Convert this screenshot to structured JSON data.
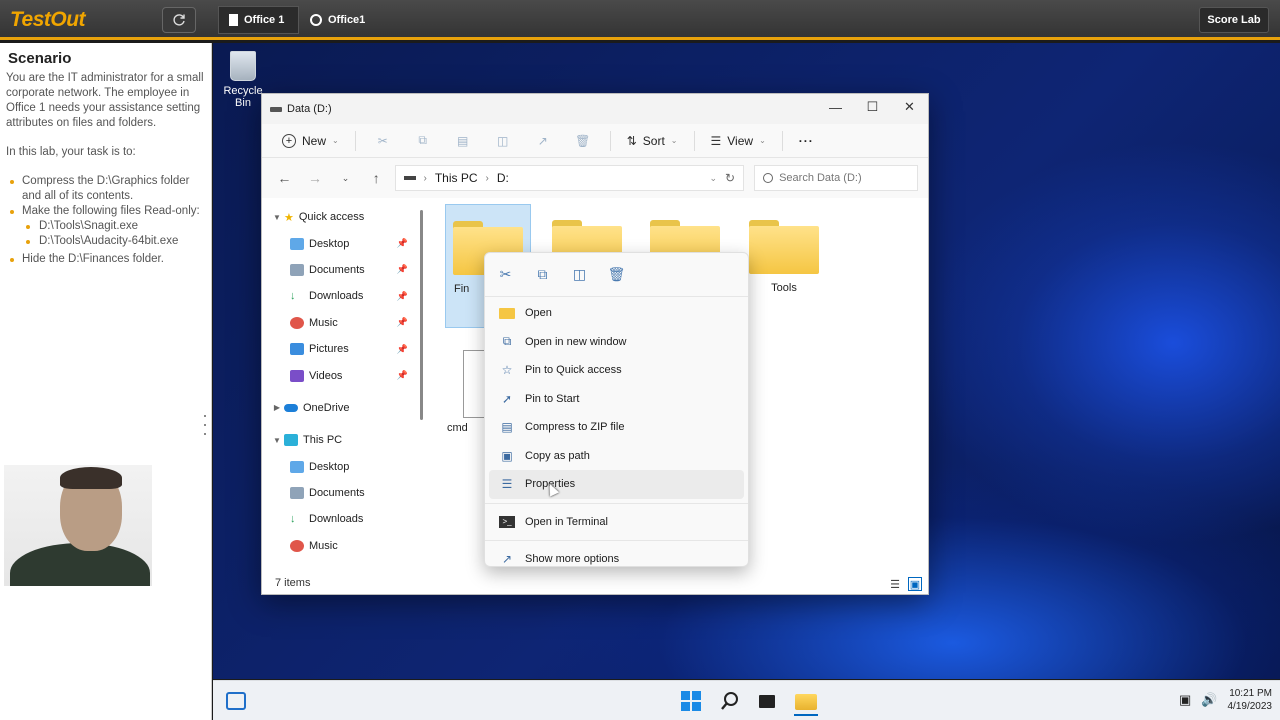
{
  "topbar": {
    "logo": "TestOut",
    "crumb1": "Office 1",
    "crumb2": "Office1",
    "score_button": "Score Lab"
  },
  "scenario": {
    "heading": "Scenario",
    "intro": "You are the IT administrator for a small corporate network. The employee in Office 1 needs your assistance setting attributes on files and folders.",
    "task_intro": "In this lab, your task is to:",
    "task1": "Compress the D:\\Graphics folder and all of its contents.",
    "task2": "Make the following files Read-only:",
    "task2_sub1": "D:\\Tools\\Snagit.exe",
    "task2_sub2": "D:\\Tools\\Audacity-64bit.exe",
    "task3": "Hide the D:\\Finances folder."
  },
  "desktop": {
    "recycle_bin": "Recycle Bin"
  },
  "explorer": {
    "title": "Data (D:)",
    "toolbar": {
      "new": "New",
      "sort": "Sort",
      "view": "View",
      "more": "···"
    },
    "address": {
      "this_pc": "This PC",
      "drive": "D:"
    },
    "search_placeholder": "Search Data (D:)",
    "nav": {
      "quick_access": "Quick access",
      "desktop": "Desktop",
      "documents": "Documents",
      "downloads": "Downloads",
      "music": "Music",
      "pictures": "Pictures",
      "videos": "Videos",
      "onedrive": "OneDrive",
      "this_pc": "This PC",
      "pc_desktop": "Desktop",
      "pc_documents": "Documents",
      "pc_downloads": "Downloads",
      "pc_music": "Music"
    },
    "items": {
      "finances_partial": "Fin",
      "tools": "Tools",
      "cmd_partial": "cmd"
    },
    "status": "7 items"
  },
  "context_menu": {
    "open": "Open",
    "open_new_window": "Open in new window",
    "pin_quick_access": "Pin to Quick access",
    "pin_start": "Pin to Start",
    "compress_zip": "Compress to ZIP file",
    "copy_path": "Copy as path",
    "properties": "Properties",
    "open_terminal": "Open in Terminal",
    "more_options": "Show more options"
  },
  "taskbar": {
    "time": "10:21 PM",
    "date": "4/19/2023"
  },
  "colors": {
    "accent": "#e8a20c",
    "folder": "#f5c643",
    "selection": "#cce4f7"
  }
}
